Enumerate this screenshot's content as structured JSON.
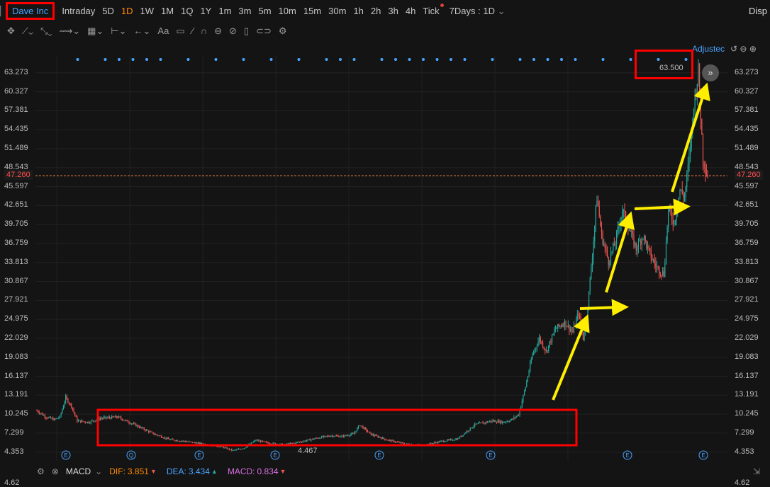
{
  "symbol": "Dave Inc",
  "timeframes": [
    "Intraday",
    "5D",
    "1D",
    "1W",
    "1M",
    "1Q",
    "1Y",
    "1m",
    "3m",
    "5m",
    "10m",
    "15m",
    "30m",
    "1h",
    "2h",
    "3h",
    "4h",
    "Tick"
  ],
  "active_timeframe": "1D",
  "period_select": "7Days : 1D",
  "display_label": "Disp",
  "adjusted_label": "Adjustec",
  "current_price": "47.260",
  "high_label": "63.500",
  "low_label": "4.467",
  "y_ticks": [
    "63.273",
    "60.327",
    "57.381",
    "54.435",
    "51.489",
    "48.543",
    "45.597",
    "42.651",
    "39.705",
    "36.759",
    "33.813",
    "30.867",
    "27.921",
    "24.975",
    "22.029",
    "19.083",
    "16.137",
    "13.191",
    "10.245",
    "7.299",
    "4.353"
  ],
  "bottom_tick": "4.62",
  "macd": {
    "label": "MACD",
    "dif_label": "DIF:",
    "dif": "3.851",
    "dea_label": "DEA:",
    "dea": "3.434",
    "macd_label": "MACD:",
    "macd_val": "0.834"
  },
  "colors": {
    "up": "#26a69a",
    "down": "#ef5350",
    "accent": "#ff8a00",
    "highlight": "#ff0000",
    "arrow": "#ffee00"
  },
  "event_markers": [
    "E",
    "Q",
    "E",
    "E",
    "E",
    "E",
    "E",
    "E"
  ],
  "chart_data": {
    "type": "candlestick",
    "ylim": [
      3.0,
      66.0
    ],
    "close_trend": [
      [
        0,
        10.8
      ],
      [
        8,
        9.8
      ],
      [
        15,
        9.4
      ],
      [
        20,
        9.8
      ],
      [
        25,
        12.8
      ],
      [
        30,
        11.5
      ],
      [
        35,
        9.2
      ],
      [
        45,
        9.0
      ],
      [
        55,
        9.6
      ],
      [
        70,
        9.8
      ],
      [
        85,
        8.6
      ],
      [
        100,
        7.3
      ],
      [
        115,
        6.3
      ],
      [
        130,
        6.0
      ],
      [
        145,
        5.6
      ],
      [
        160,
        5.2
      ],
      [
        170,
        4.6
      ],
      [
        180,
        5.0
      ],
      [
        190,
        6.2
      ],
      [
        200,
        5.8
      ],
      [
        215,
        5.5
      ],
      [
        230,
        6.0
      ],
      [
        245,
        6.6
      ],
      [
        255,
        6.9
      ],
      [
        265,
        6.8
      ],
      [
        275,
        7.2
      ],
      [
        280,
        8.6
      ],
      [
        290,
        7.1
      ],
      [
        305,
        6.2
      ],
      [
        320,
        5.6
      ],
      [
        335,
        5.4
      ],
      [
        350,
        6.0
      ],
      [
        365,
        6.4
      ],
      [
        380,
        8.6
      ],
      [
        395,
        9.2
      ],
      [
        405,
        9.0
      ],
      [
        412,
        9.4
      ],
      [
        418,
        10.2
      ],
      [
        424,
        14.5
      ],
      [
        430,
        19.5
      ],
      [
        436,
        22.0
      ],
      [
        442,
        20.0
      ],
      [
        450,
        23.5
      ],
      [
        458,
        24.5
      ],
      [
        465,
        23.0
      ],
      [
        470,
        26.0
      ],
      [
        474,
        22.0
      ],
      [
        478,
        27.0
      ],
      [
        482,
        35.0
      ],
      [
        486,
        44.0
      ],
      [
        490,
        38.0
      ],
      [
        496,
        34.0
      ],
      [
        502,
        37.0
      ],
      [
        508,
        42.0
      ],
      [
        514,
        39.0
      ],
      [
        520,
        36.0
      ],
      [
        526,
        38.0
      ],
      [
        532,
        35.0
      ],
      [
        538,
        33.0
      ],
      [
        544,
        32.0
      ],
      [
        548,
        42.0
      ],
      [
        553,
        40.0
      ],
      [
        558,
        45.0
      ],
      [
        562,
        44.0
      ],
      [
        566,
        50.0
      ],
      [
        570,
        58.0
      ],
      [
        574,
        63.5
      ],
      [
        578,
        50.0
      ],
      [
        582,
        47.3
      ]
    ]
  }
}
